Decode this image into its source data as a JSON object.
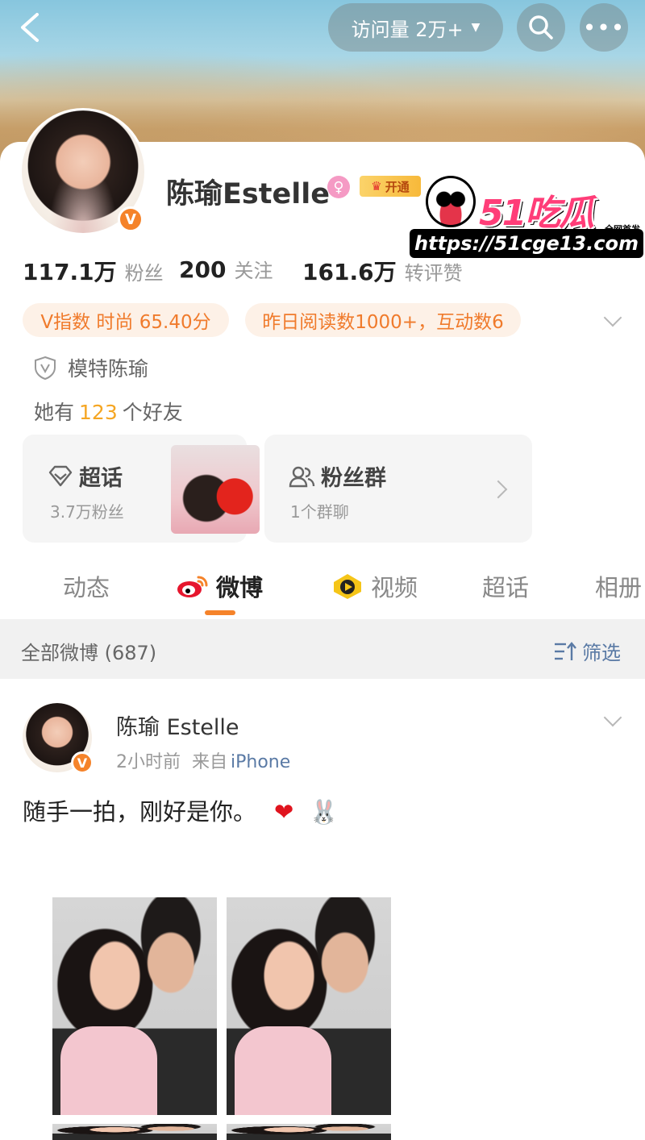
{
  "header": {
    "back_icon": "chevron-left-icon",
    "visits_label": "访问量 2万+",
    "search_icon": "search-icon",
    "more_icon": "more-icon"
  },
  "profile": {
    "name": "陈瑜Estelle",
    "vip_label": "开通",
    "verified_badge": "V",
    "stats": [
      {
        "num": "117.1万",
        "label": "粉丝"
      },
      {
        "num": "200",
        "label": "关注"
      },
      {
        "num": "161.6万",
        "label": "转评赞"
      }
    ],
    "pills": [
      "V指数 时尚 65.40分",
      "昨日阅读数1000+，互动数6"
    ],
    "certification": "模特陈瑜",
    "friends_prefix": "她有",
    "friends_count": "123",
    "friends_suffix": "个好友"
  },
  "watermark": {
    "logo": "51吃瓜",
    "tag": "全网首发",
    "url": "https://51cge13.com"
  },
  "tiles": {
    "super_topic": {
      "title": "超话",
      "sub": "3.7万粉丝"
    },
    "fan_group": {
      "title": "粉丝群",
      "sub": "1个群聊"
    }
  },
  "tabs": [
    "动态",
    "微博",
    "视频",
    "超话",
    "相册"
  ],
  "feed": {
    "all_label": "全部微博 (687)",
    "filter_label": "筛选"
  },
  "post": {
    "author": "陈瑜 Estelle",
    "time": "2小时前",
    "source_prefix": "来自",
    "source": "iPhone",
    "text": "随手一拍，刚好是你。",
    "emoji_heart": "❤",
    "emoji_rabbit": "🐰"
  },
  "colors": {
    "accent": "#f5832a",
    "link": "#5a7aa5",
    "pill_bg": "#fdf1e7"
  }
}
